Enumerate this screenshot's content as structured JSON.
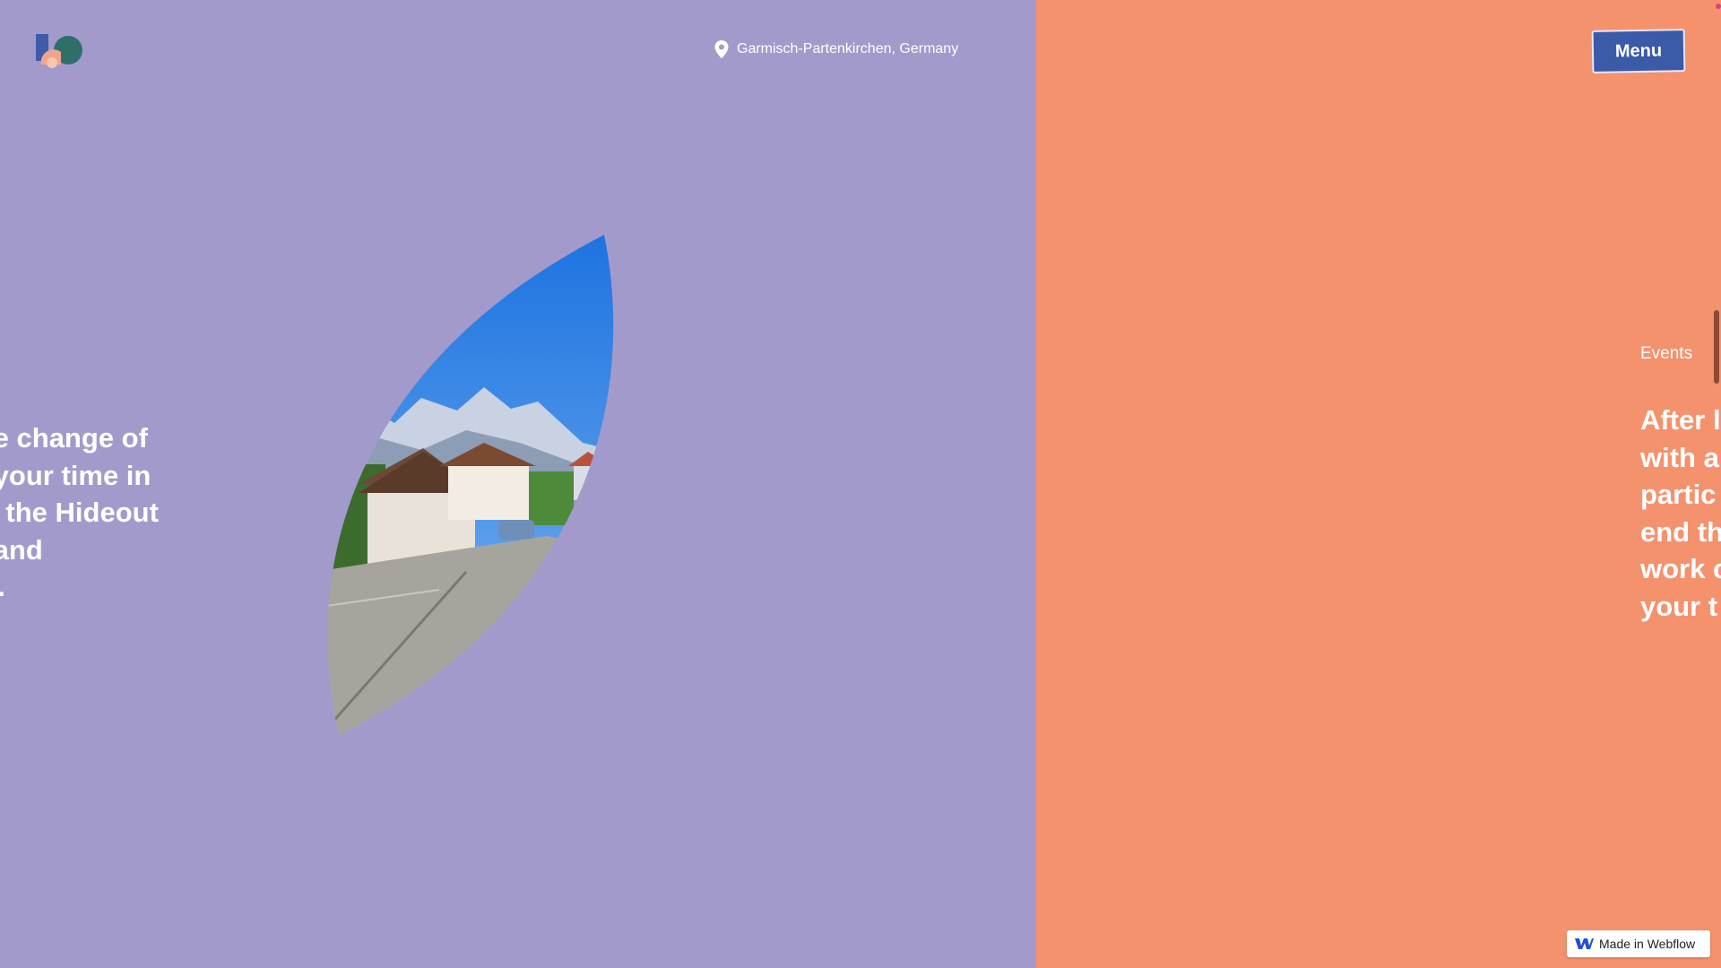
{
  "header": {
    "location_text": "Garmisch-Partenkirchen, Germany",
    "menu_label": "Menu"
  },
  "intro": {
    "lines": [
      "joy the change of",
      "t and your time in",
      "urn to the Hideout",
      "mind and",
      "ativity."
    ]
  },
  "right_panel": {
    "section_label": "Events",
    "lines": [
      "After l",
      "with a",
      "partic",
      "end th",
      "work c",
      "your t"
    ]
  },
  "badge": {
    "label": "Made in Webflow"
  },
  "colors": {
    "left_background": "#a39acc",
    "right_background": "#f4926e",
    "menu_button": "#3b5aa8"
  },
  "icons": {
    "location": "location-pin-icon",
    "logo": "hideout-logo-icon",
    "webflow": "webflow-icon"
  }
}
